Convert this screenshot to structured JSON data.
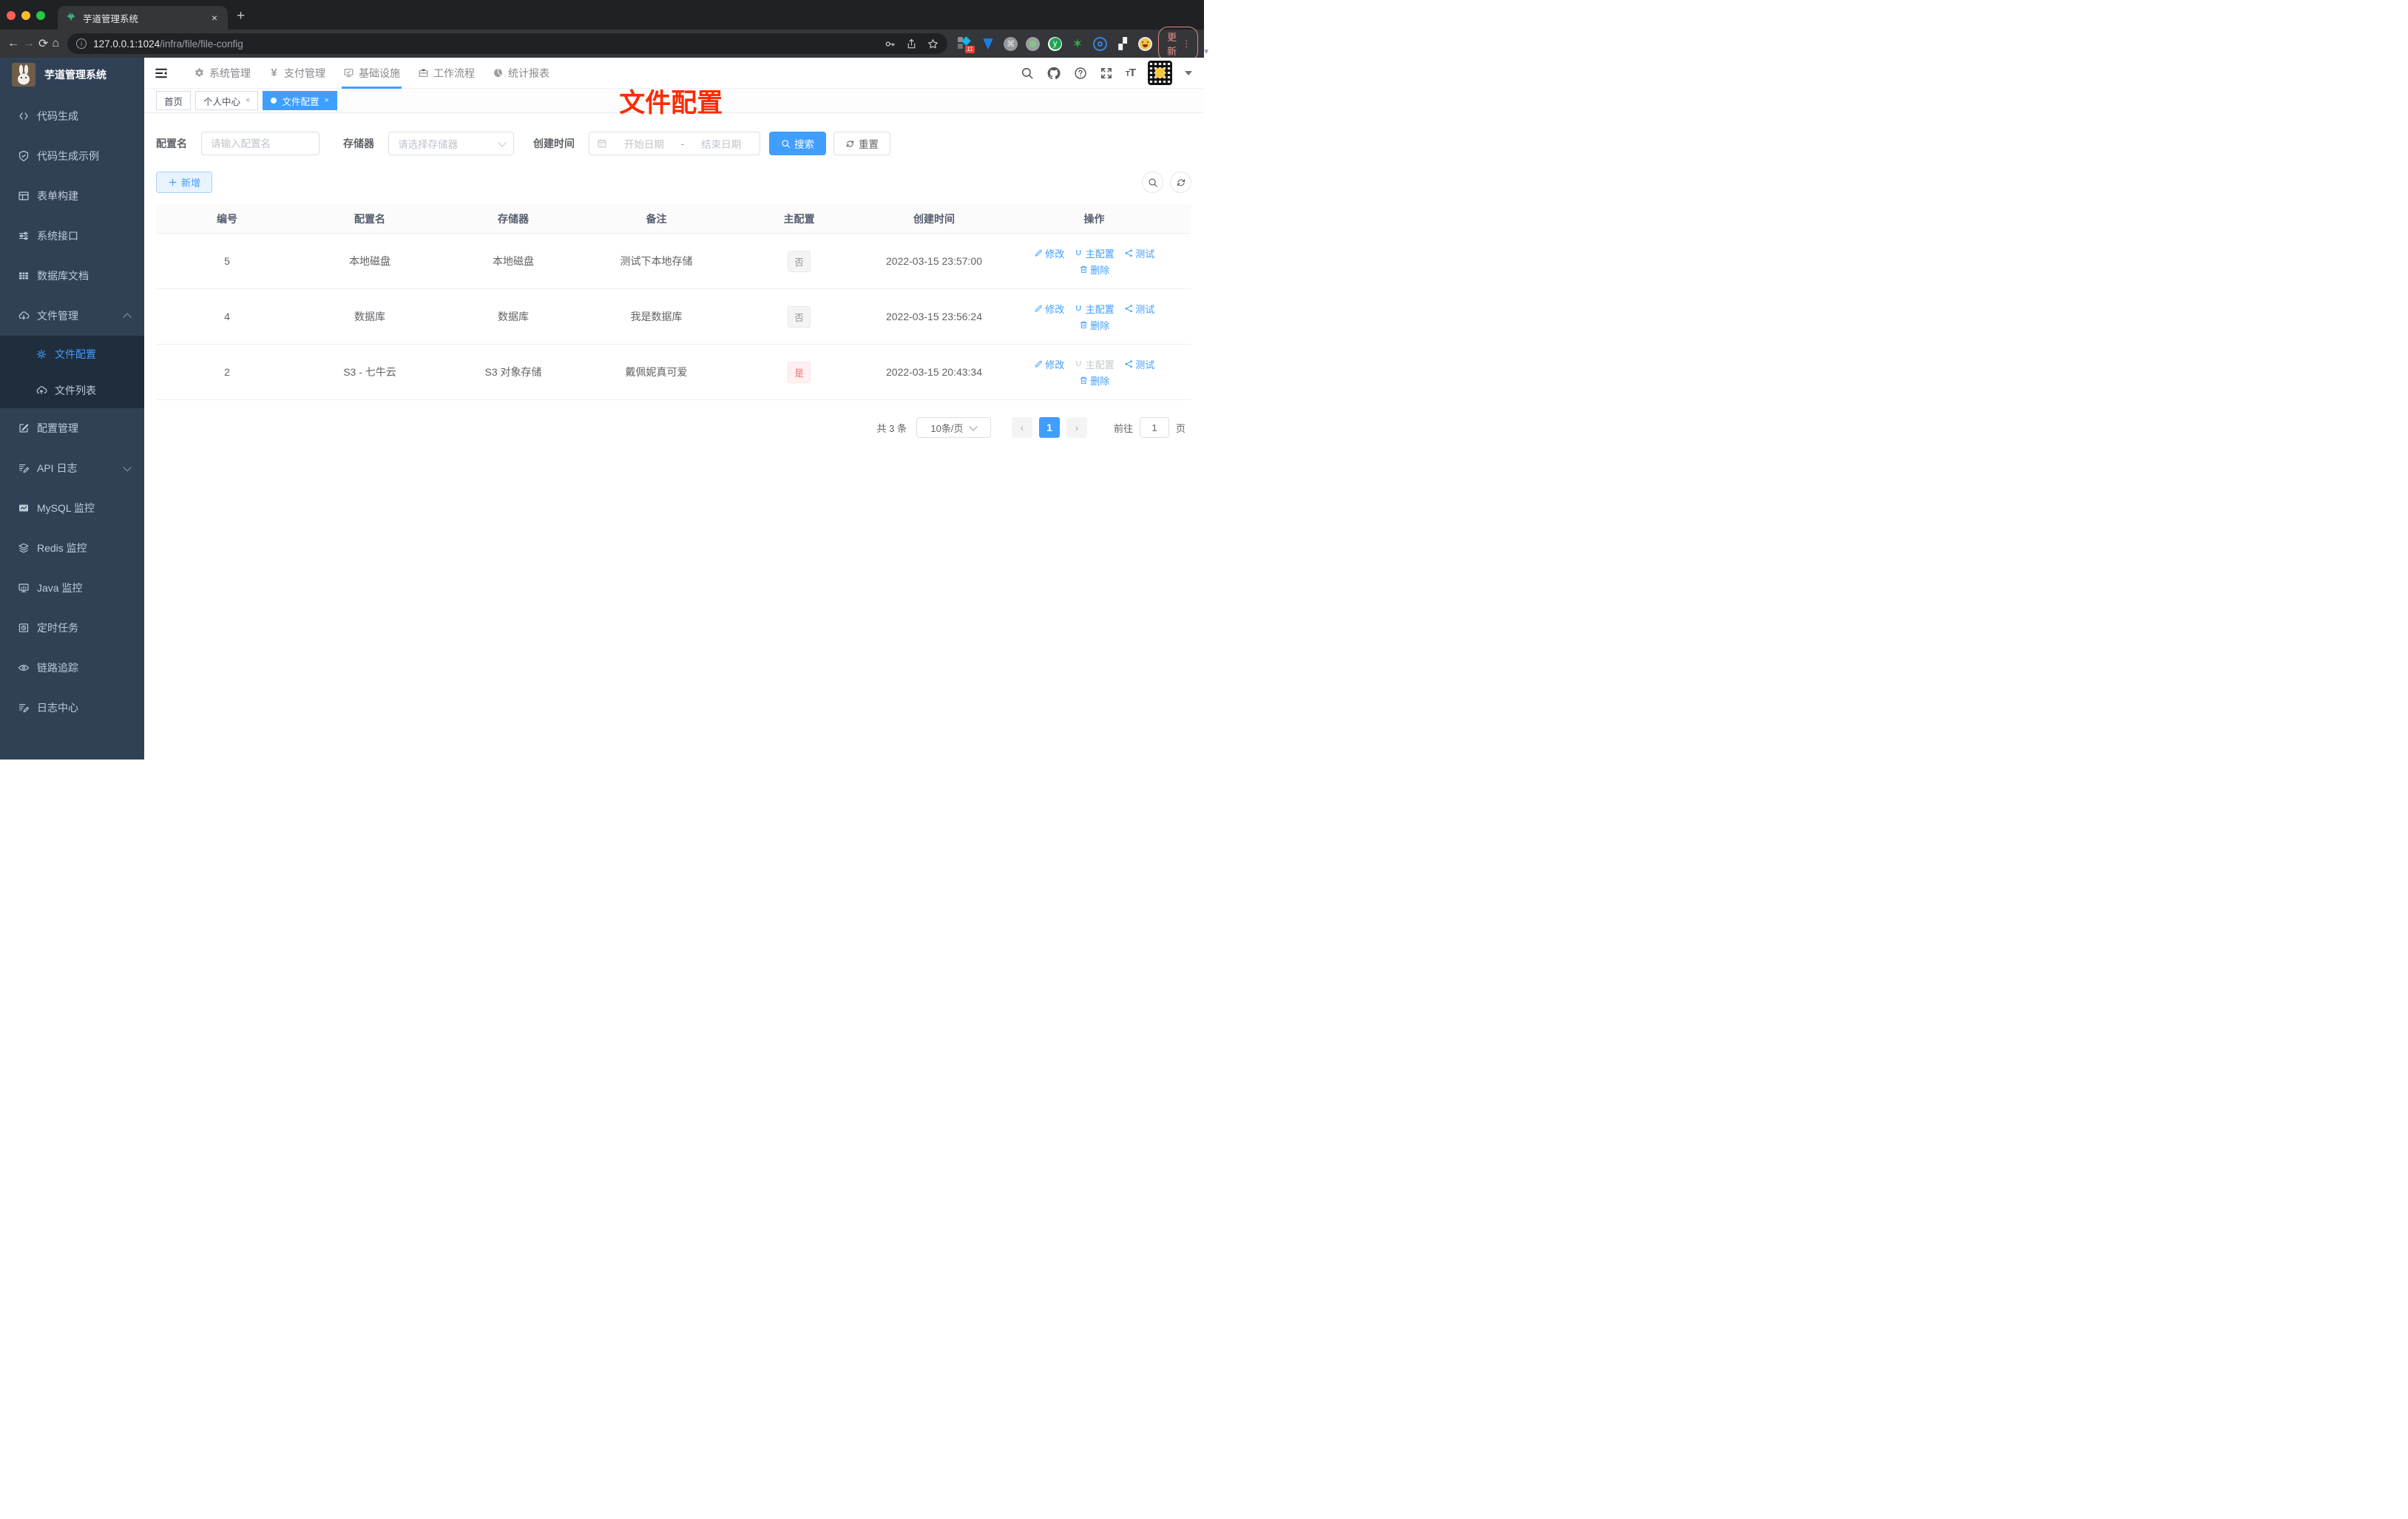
{
  "colors": {
    "accent": "#409eff",
    "danger": "#f56c6c",
    "annotation_red": "#fe2b01",
    "sidebar_bg": "#304156",
    "submenu_bg": "#1f2d3d"
  },
  "browser": {
    "tab": {
      "title": "芋道管理系统",
      "close": "×",
      "new_tab": "+"
    },
    "url": {
      "host": "127.0.0.1:1024",
      "path": "/infra/file/file-config"
    },
    "extensions_badge": "11",
    "update_label": "更新"
  },
  "sidebar": {
    "logo_title": "芋道管理系统",
    "items": [
      {
        "label": "代码生成"
      },
      {
        "label": "代码生成示例"
      },
      {
        "label": "表单构建"
      },
      {
        "label": "系统接口"
      },
      {
        "label": "数据库文档"
      },
      {
        "label": "文件管理"
      },
      {
        "label": "文件配置"
      },
      {
        "label": "文件列表"
      },
      {
        "label": "配置管理"
      },
      {
        "label": "API 日志"
      },
      {
        "label": "MySQL 监控"
      },
      {
        "label": "Redis 监控"
      },
      {
        "label": "Java 监控"
      },
      {
        "label": "定时任务"
      },
      {
        "label": "链路追踪"
      },
      {
        "label": "日志中心"
      }
    ]
  },
  "topnav": {
    "items": [
      {
        "label": "系统管理"
      },
      {
        "label": "支付管理"
      },
      {
        "label": "基础设施"
      },
      {
        "label": "工作流程"
      },
      {
        "label": "统计报表"
      }
    ]
  },
  "route_tabs": {
    "items": [
      {
        "label": "首页"
      },
      {
        "label": "个人中心",
        "close": "×"
      },
      {
        "label": "文件配置",
        "close": "×"
      }
    ]
  },
  "overlay_title": "文件配置",
  "filters": {
    "name_label": "配置名",
    "name_placeholder": "请输入配置名",
    "storage_label": "存储器",
    "storage_placeholder": "请选择存储器",
    "time_label": "创建时间",
    "start_placeholder": "开始日期",
    "separator": "-",
    "end_placeholder": "结束日期",
    "search_label": "搜索",
    "reset_label": "重置"
  },
  "toolbar": {
    "add_label": "新增"
  },
  "table": {
    "headers": [
      "编号",
      "配置名",
      "存储器",
      "备注",
      "主配置",
      "创建时间",
      "操作"
    ],
    "rows": [
      {
        "id": "5",
        "name": "本地磁盘",
        "storage": "本地磁盘",
        "remark": "测试下本地存储",
        "master": "否",
        "master_type": "info",
        "created": "2022-03-15 23:57:00",
        "edit": "修改",
        "master_action": "主配置",
        "test": "测试",
        "delete": "删除",
        "master_disabled": "false"
      },
      {
        "id": "4",
        "name": "数据库",
        "storage": "数据库",
        "remark": "我是数据库",
        "master": "否",
        "master_type": "info",
        "created": "2022-03-15 23:56:24",
        "edit": "修改",
        "master_action": "主配置",
        "test": "测试",
        "delete": "删除",
        "master_disabled": "false"
      },
      {
        "id": "2",
        "name": "S3 - 七牛云",
        "storage": "S3 对象存储",
        "remark": "戴佩妮真可爱",
        "master": "是",
        "master_type": "danger",
        "created": "2022-03-15 20:43:34",
        "edit": "修改",
        "master_action": "主配置",
        "test": "测试",
        "delete": "删除",
        "master_disabled": "true"
      }
    ]
  },
  "pagination": {
    "total": "共 3 条",
    "page_size": "10条/页",
    "prev": "‹",
    "page": "1",
    "next": "›",
    "goto_label": "前往",
    "goto_value": "1",
    "unit_label": "页"
  }
}
